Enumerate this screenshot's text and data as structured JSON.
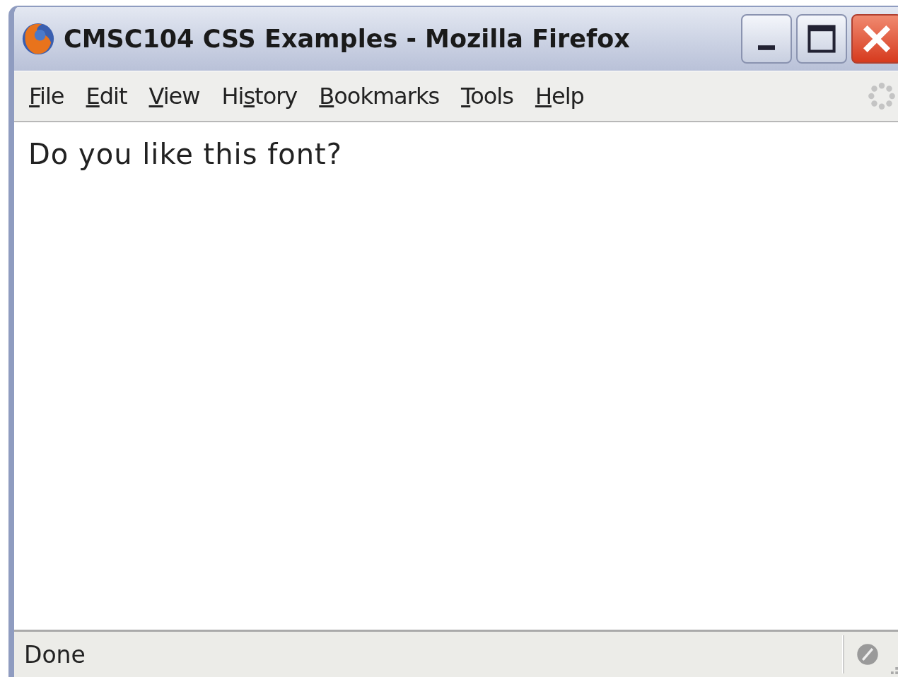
{
  "window": {
    "title": "CMSC104 CSS Examples - Mozilla Firefox"
  },
  "menu": [
    {
      "key": "F",
      "post": "ile"
    },
    {
      "key": "E",
      "post": "dit"
    },
    {
      "key": "V",
      "post": "iew"
    },
    {
      "pre": "Hi",
      "key": "s",
      "post": "tory"
    },
    {
      "key": "B",
      "post": "ookmarks"
    },
    {
      "key": "T",
      "post": "ools"
    },
    {
      "key": "H",
      "post": "elp"
    }
  ],
  "content": {
    "text": "Do you like this font?"
  },
  "status_bar": {
    "text": "Done"
  }
}
